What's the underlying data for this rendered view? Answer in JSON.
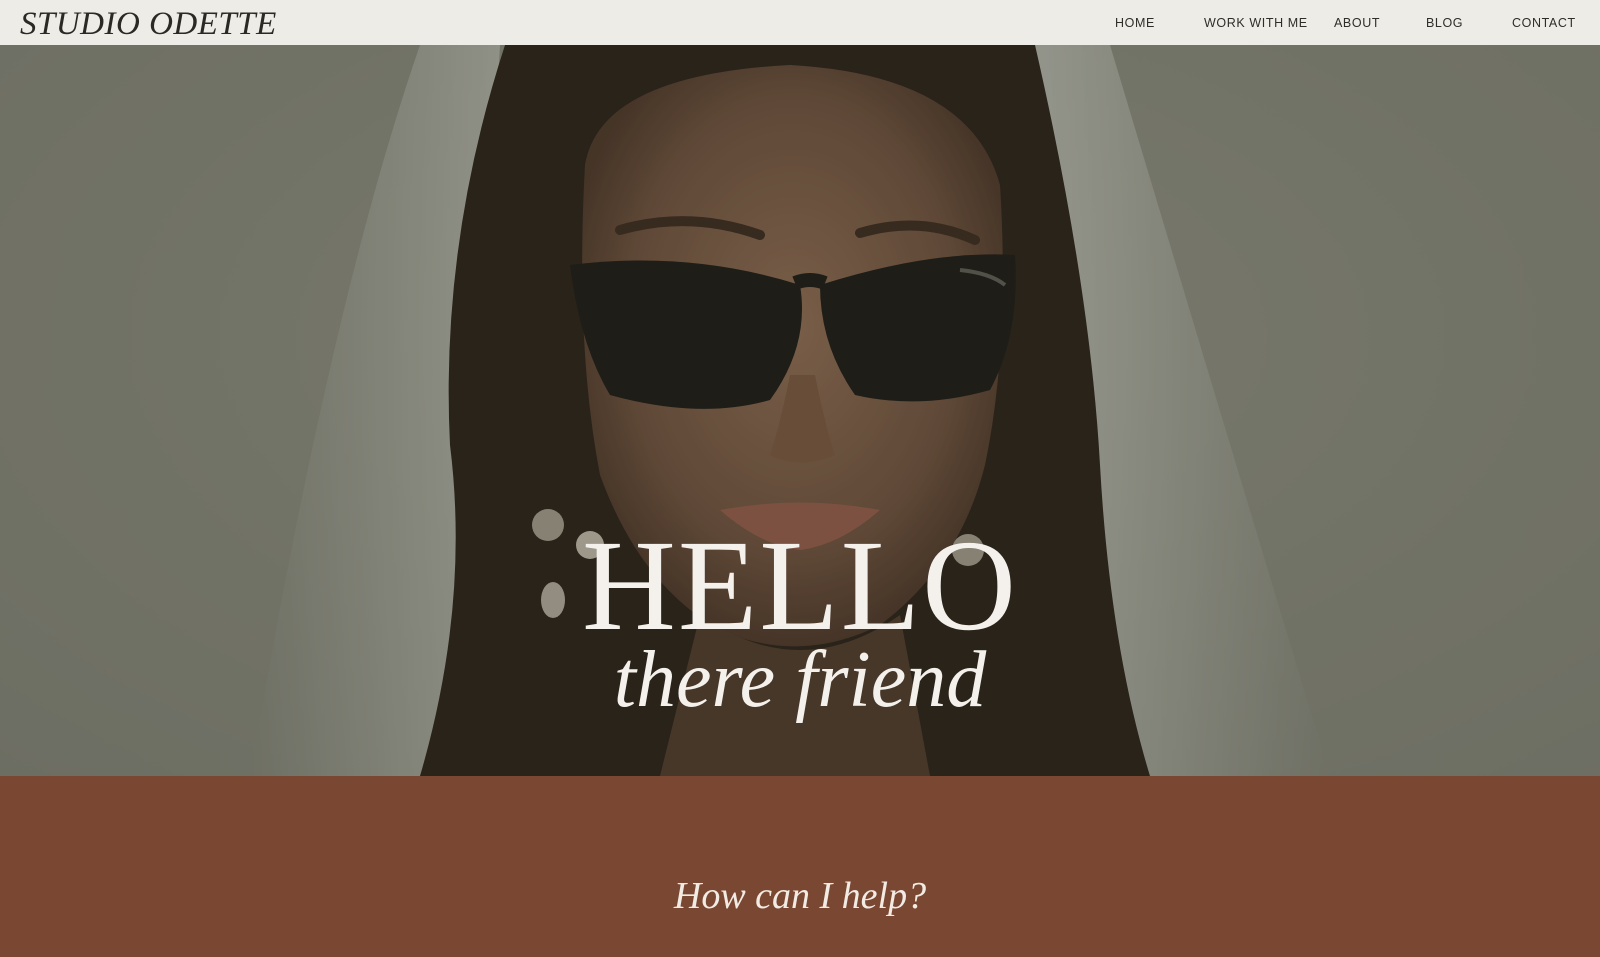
{
  "brand": {
    "name": "STUDIO ODETTE"
  },
  "nav": {
    "home": "HOME",
    "work": "WORK WITH ME",
    "about": "ABOUT",
    "blog": "BLOG",
    "contact": "CONTACT"
  },
  "hero": {
    "headline": "HELLO",
    "subheadline": "there friend"
  },
  "help_section": {
    "title": "How can I help?"
  },
  "colors": {
    "topbar": "#eeece7",
    "hero_overlay": "#828377",
    "accent": "#7a4733",
    "text_light": "#f4f1ec"
  }
}
